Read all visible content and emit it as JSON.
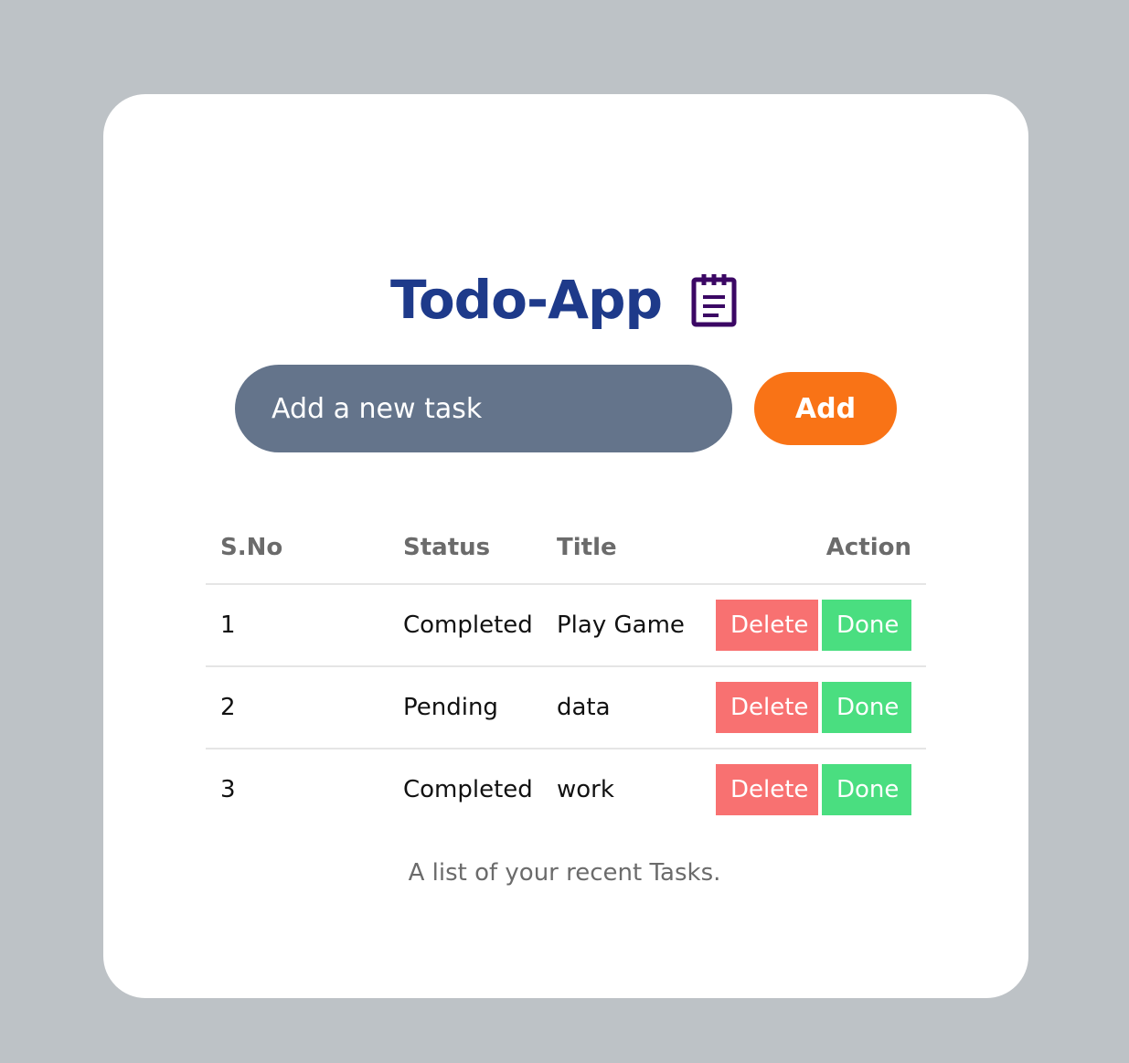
{
  "app": {
    "title": "Todo-App",
    "title_icon": "clipboard-icon",
    "colors": {
      "background": "#bdc2c6",
      "card": "#ffffff",
      "title": "#1e3a8a",
      "icon": "#3b0764",
      "input": "#64748b",
      "add_button": "#f97316",
      "delete_button": "#f87171",
      "done_button": "#4ade80"
    }
  },
  "input": {
    "placeholder": "Add a new task",
    "value": ""
  },
  "add_button": {
    "label": "Add"
  },
  "table": {
    "headers": [
      "S.No",
      "Status",
      "Title",
      "Action"
    ],
    "rows": [
      {
        "sno": "1",
        "status": "Completed",
        "title": "Play Game",
        "delete_label": "Delete",
        "done_label": "Done"
      },
      {
        "sno": "2",
        "status": "Pending",
        "title": "data",
        "delete_label": "Delete",
        "done_label": "Done"
      },
      {
        "sno": "3",
        "status": "Completed",
        "title": "work",
        "delete_label": "Delete",
        "done_label": "Done"
      }
    ],
    "caption": "A list of your recent Tasks."
  }
}
